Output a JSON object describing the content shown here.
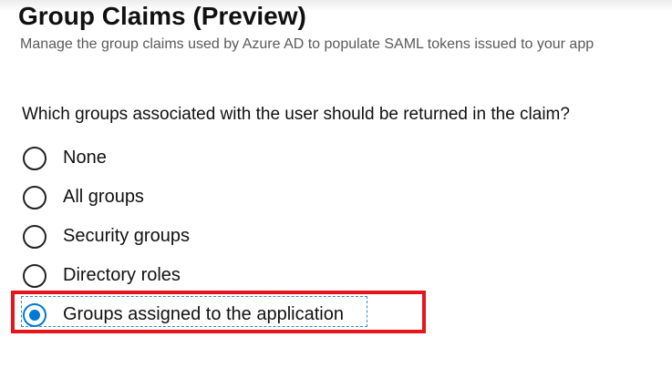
{
  "header": {
    "title": "Group Claims (Preview)",
    "subtitle": "Manage the group claims used by Azure AD to populate SAML tokens issued to your app"
  },
  "question": "Which groups associated with the user should be returned in the claim?",
  "options": [
    {
      "label": "None",
      "checked": false
    },
    {
      "label": "All groups",
      "checked": false
    },
    {
      "label": "Security groups",
      "checked": false
    },
    {
      "label": "Directory roles",
      "checked": false
    },
    {
      "label": "Groups assigned to the application",
      "checked": true
    }
  ],
  "colors": {
    "accent": "#0078d4",
    "highlight": "#e8141b"
  }
}
